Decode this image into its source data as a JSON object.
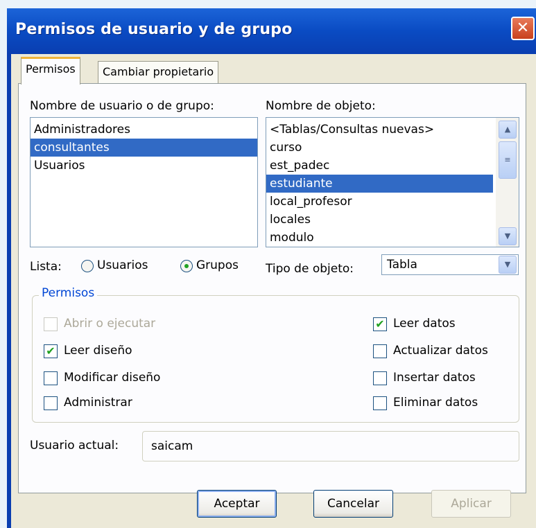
{
  "window": {
    "title": "Permisos de usuario y de grupo",
    "close_glyph": "✕"
  },
  "tabs": [
    {
      "label": "Permisos",
      "active": true
    },
    {
      "label": "Cambiar propietario",
      "active": false
    }
  ],
  "users": {
    "label": "Nombre de usuario o de grupo:",
    "items": [
      "Administradores",
      "consultantes",
      "Usuarios"
    ],
    "selected": "consultantes"
  },
  "objects": {
    "label": "Nombre de objeto:",
    "items": [
      "<Tablas/Consultas nuevas>",
      "curso",
      "est_padec",
      "estudiante",
      "local_profesor",
      "locales",
      "modulo"
    ],
    "selected": "estudiante"
  },
  "list_filter": {
    "label": "Lista:",
    "options": [
      "Usuarios",
      "Grupos"
    ],
    "selected": "Grupos"
  },
  "object_type": {
    "label": "Tipo de objeto:",
    "value": "Tabla"
  },
  "permissions": {
    "legend": "Permisos",
    "left": [
      {
        "label": "Abrir o ejecutar",
        "checked": false,
        "disabled": true
      },
      {
        "label": "Leer diseño",
        "checked": true,
        "disabled": false
      },
      {
        "label": "Modificar diseño",
        "checked": false,
        "disabled": false
      },
      {
        "label": "Administrar",
        "checked": false,
        "disabled": false
      }
    ],
    "right": [
      {
        "label": "Leer datos",
        "checked": true,
        "disabled": false
      },
      {
        "label": "Actualizar datos",
        "checked": false,
        "disabled": false
      },
      {
        "label": "Insertar datos",
        "checked": false,
        "disabled": false
      },
      {
        "label": "Eliminar datos",
        "checked": false,
        "disabled": false
      }
    ]
  },
  "current_user": {
    "label": "Usuario actual:",
    "value": "saicam"
  },
  "buttons": {
    "ok": "Aceptar",
    "cancel": "Cancelar",
    "apply": "Aplicar"
  },
  "icons": {
    "check": "✔",
    "scroll_up": "▲",
    "scroll_down": "▼",
    "scroll_grip": "≡",
    "combo_arrow": "▼"
  }
}
